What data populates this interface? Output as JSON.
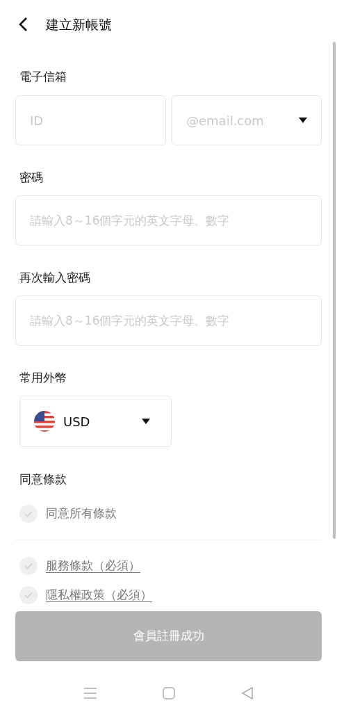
{
  "header": {
    "title": "建立新帳號"
  },
  "email": {
    "label": "電子信箱",
    "id_placeholder": "ID",
    "domain_placeholder": "@email.com"
  },
  "password": {
    "label": "密碼",
    "placeholder": "請輸入8～16個字元的英文字母、數字"
  },
  "password_confirm": {
    "label": "再次輸入密碼",
    "placeholder": "請輸入8～16個字元的英文字母、數字"
  },
  "currency": {
    "label": "常用外幣",
    "value": "USD"
  },
  "terms": {
    "label": "同意條款",
    "items": [
      {
        "kind": "all",
        "text": "同意所有條款",
        "checked": false
      },
      {
        "kind": "link",
        "text": "服務條款（必須）",
        "checked": false
      },
      {
        "kind": "link",
        "text": "隱私權政策（必須）",
        "checked": false
      }
    ]
  },
  "submit": {
    "label": "會員註冊成功",
    "disabled": true
  }
}
